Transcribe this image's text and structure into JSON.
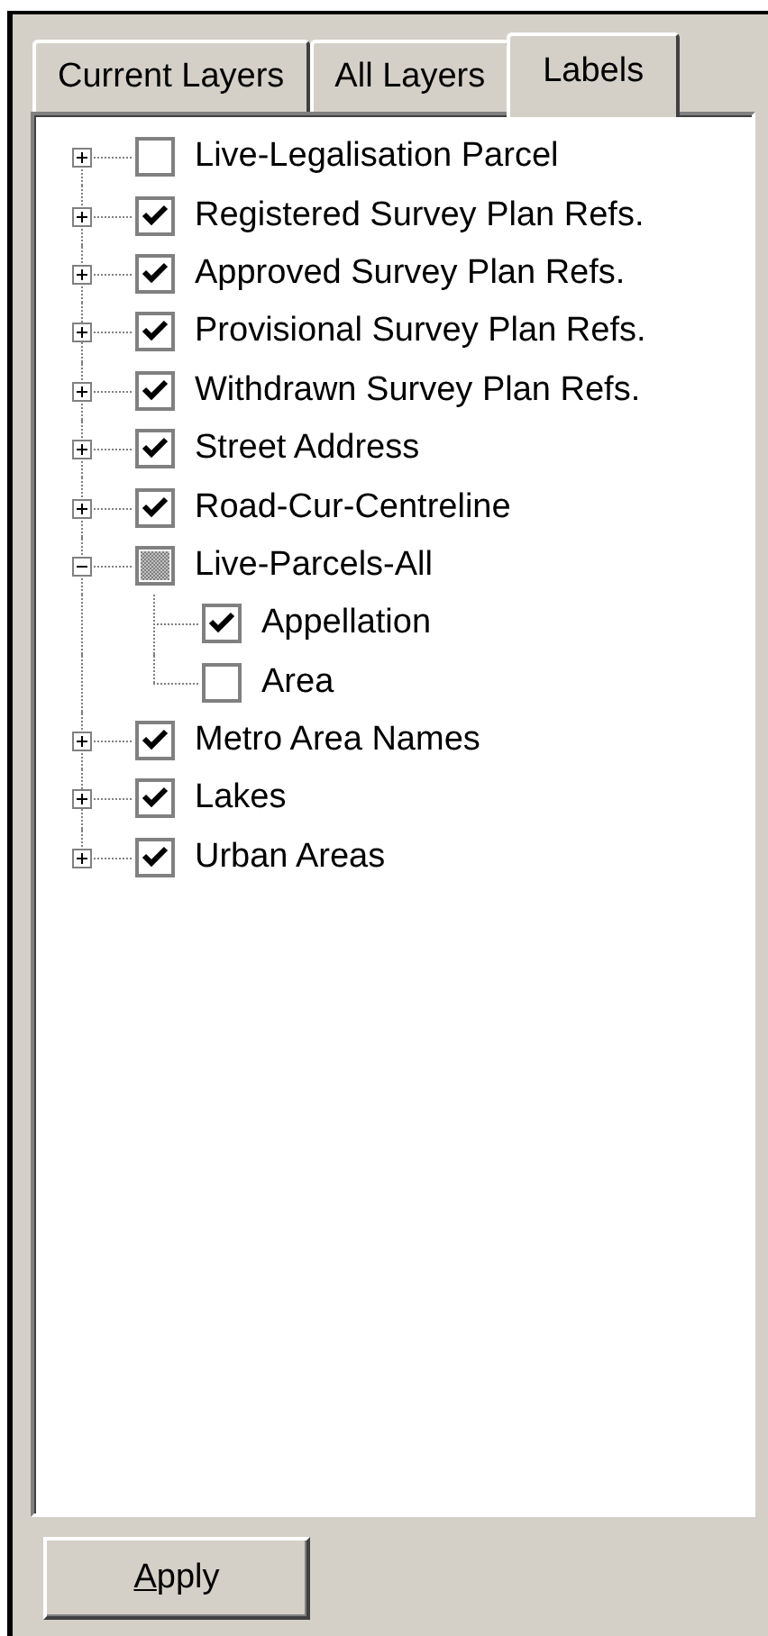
{
  "tabs": [
    {
      "label": "Current Layers",
      "selected": false
    },
    {
      "label": "All Layers",
      "selected": false
    },
    {
      "label": "Labels",
      "selected": true
    }
  ],
  "tree": [
    {
      "label": "Live-Legalisation Parcel",
      "checked": false,
      "expanded": false
    },
    {
      "label": "Registered Survey Plan Refs.",
      "checked": true,
      "expanded": false
    },
    {
      "label": "Approved Survey Plan Refs.",
      "checked": true,
      "expanded": false
    },
    {
      "label": "Provisional Survey Plan Refs.",
      "checked": true,
      "expanded": false
    },
    {
      "label": "Withdrawn Survey Plan Refs.",
      "checked": true,
      "expanded": false
    },
    {
      "label": "Street Address",
      "checked": true,
      "expanded": false
    },
    {
      "label": "Road-Cur-Centreline",
      "checked": true,
      "expanded": false
    },
    {
      "label": "Live-Parcels-All",
      "checked": false,
      "indeterminate": true,
      "expanded": true,
      "children": [
        {
          "label": "Appellation",
          "checked": true
        },
        {
          "label": "Area",
          "checked": false
        }
      ]
    },
    {
      "label": "Metro Area Names",
      "checked": true,
      "expanded": false
    },
    {
      "label": "Lakes",
      "checked": true,
      "expanded": false
    },
    {
      "label": "Urban Areas",
      "checked": true,
      "expanded": false
    }
  ],
  "apply_button": {
    "label": "Apply"
  }
}
